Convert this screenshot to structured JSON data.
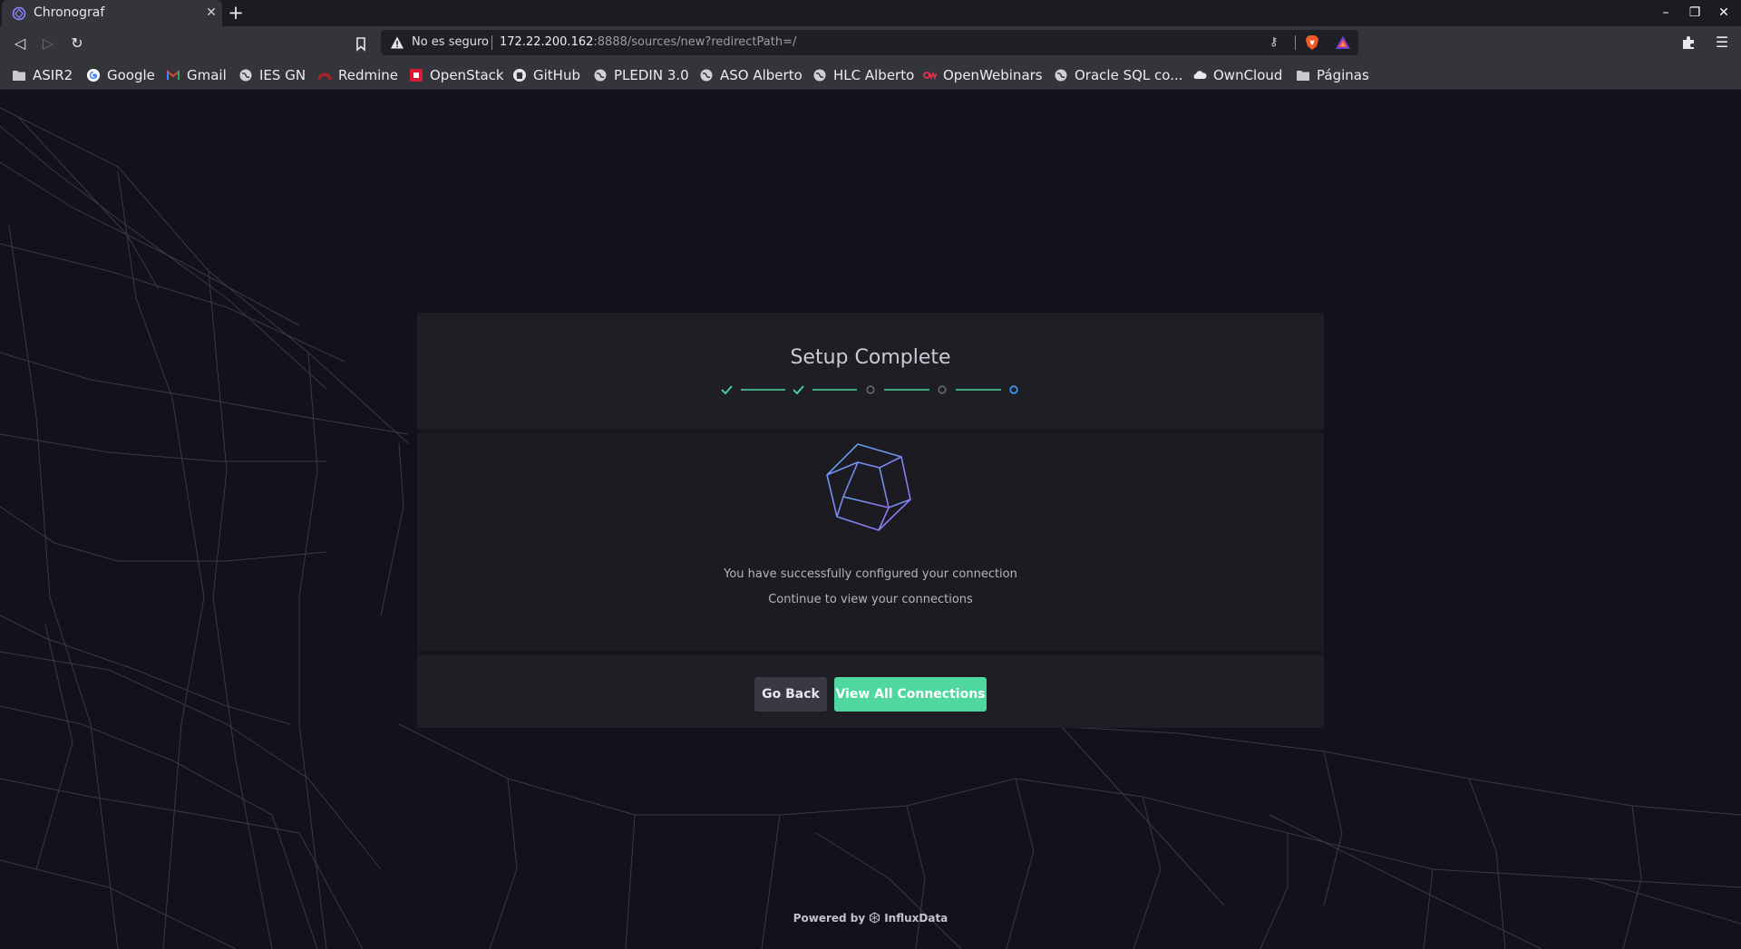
{
  "browser": {
    "tab": {
      "title": "Chronograf",
      "favicon": "chronograf-icon"
    },
    "url": {
      "security_label": "No es seguro",
      "host": "172.22.200.162",
      "path": ":8888/sources/new?redirectPath=/"
    },
    "bookmarks": [
      {
        "label": "ASIR2",
        "icon": "folder-icon"
      },
      {
        "label": "Google",
        "icon": "google-icon"
      },
      {
        "label": "Gmail",
        "icon": "gmail-icon"
      },
      {
        "label": "IES GN",
        "icon": "globe-icon"
      },
      {
        "label": "Redmine",
        "icon": "redmine-icon"
      },
      {
        "label": "OpenStack",
        "icon": "openstack-icon"
      },
      {
        "label": "GitHub",
        "icon": "github-icon"
      },
      {
        "label": "PLEDIN 3.0",
        "icon": "globe-icon"
      },
      {
        "label": "ASO Alberto",
        "icon": "globe-icon"
      },
      {
        "label": "HLC Alberto",
        "icon": "globe-icon"
      },
      {
        "label": "OpenWebinars",
        "icon": "openwebinars-icon"
      },
      {
        "label": "Oracle SQL co...",
        "icon": "globe-icon"
      },
      {
        "label": "OwnCloud",
        "icon": "owncloud-icon"
      },
      {
        "label": "Páginas",
        "icon": "folder-icon"
      }
    ]
  },
  "setup": {
    "title": "Setup Complete",
    "steps": [
      "complete",
      "complete",
      "incomplete",
      "incomplete",
      "current"
    ],
    "message_line1": "You have successfully configured your connection",
    "message_line2": "Continue to view your connections",
    "back_label": "Go Back",
    "view_label": "View All Connections"
  },
  "footer": {
    "powered_by": "Powered by",
    "brand": "InfluxData"
  },
  "colors": {
    "accent_green": "#4ed8a0",
    "step_blue": "#4591ed",
    "step_pending": "#676978",
    "page_bg": "#12121c"
  }
}
